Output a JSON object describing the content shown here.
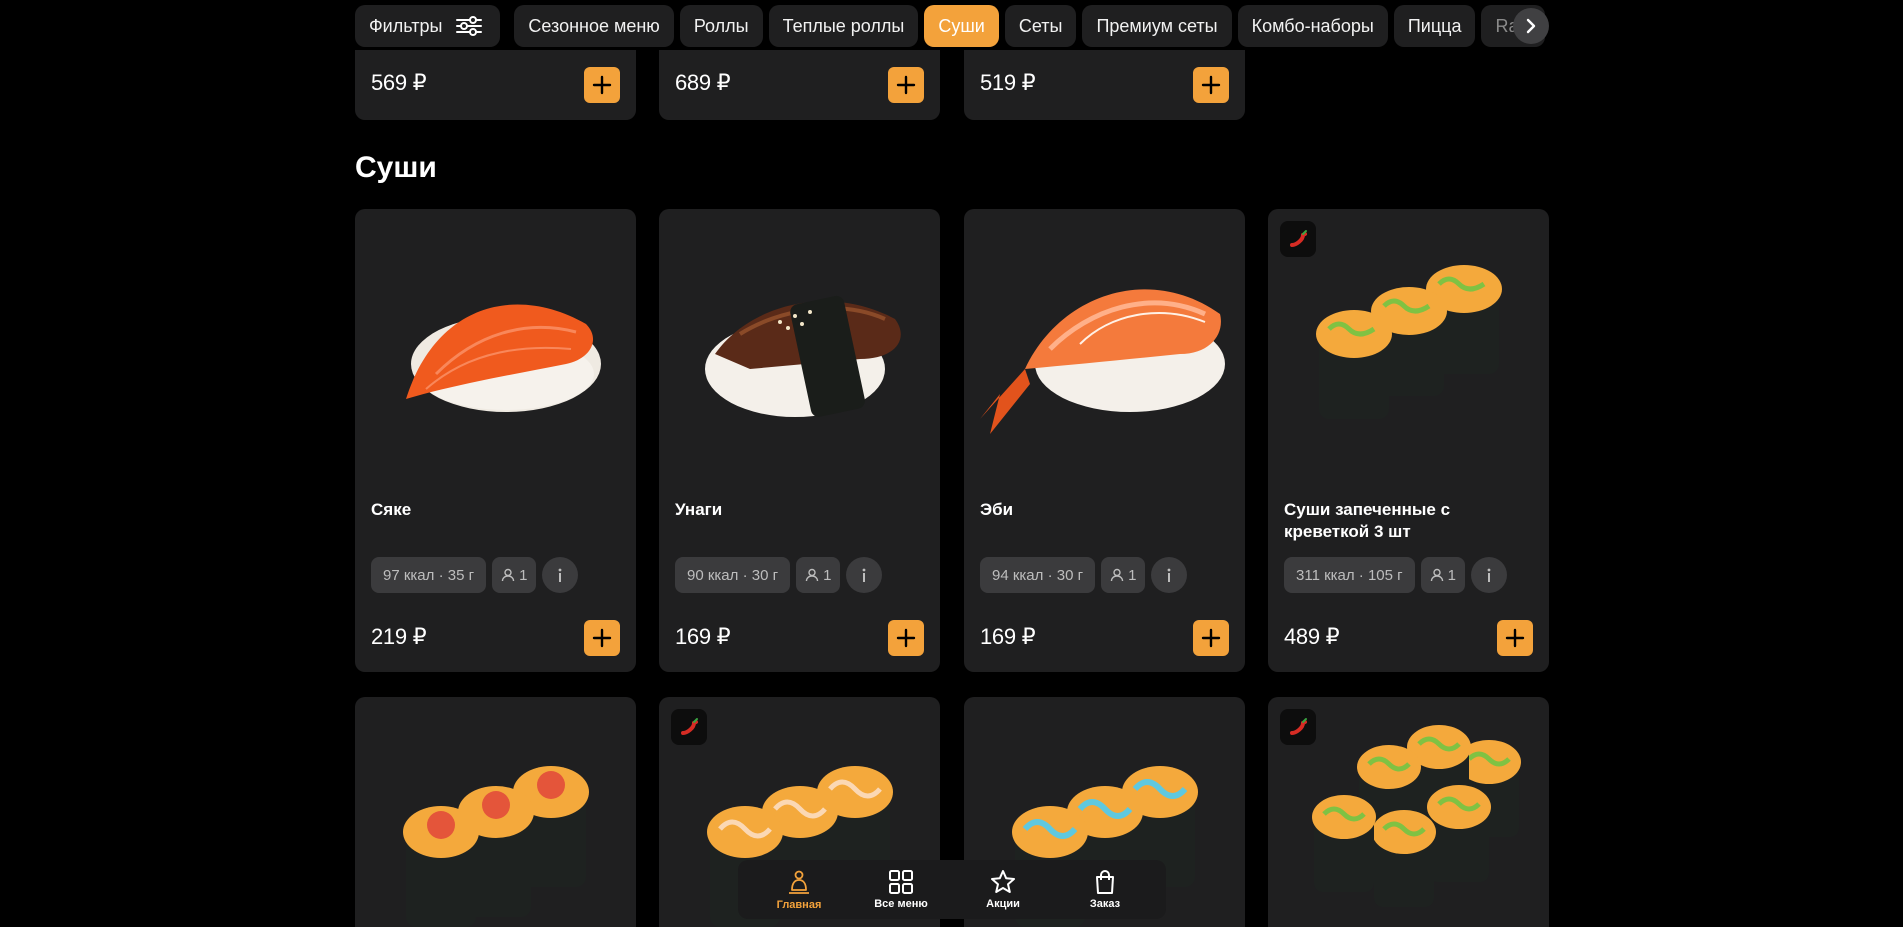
{
  "nav": {
    "filters_label": "Фильтры",
    "categories": [
      "Сезонное меню",
      "Роллы",
      "Теплые роллы",
      "Суши",
      "Сеты",
      "Премиум сеты",
      "Комбо-наборы",
      "Пицца",
      "Raw"
    ],
    "active_category": "Суши"
  },
  "previous_section": {
    "prices": [
      "569 ₽",
      "689 ₽",
      "519 ₽"
    ]
  },
  "section": {
    "title": "Суши",
    "products": [
      {
        "name": "Сяке",
        "nutrition": "97 ккал · 35 г",
        "persons": "1",
        "price": "219 ₽",
        "spicy": false,
        "image": "salmon-nigiri"
      },
      {
        "name": "Унаги",
        "nutrition": "90 ккал · 30 г",
        "persons": "1",
        "price": "169 ₽",
        "spicy": false,
        "image": "eel-nigiri"
      },
      {
        "name": "Эби",
        "nutrition": "94 ккал · 30 г",
        "persons": "1",
        "price": "169 ₽",
        "spicy": false,
        "image": "shrimp-nigiri"
      },
      {
        "name": "Суши запеченные с креветкой 3 шт",
        "nutrition": "311 ккал · 105 г",
        "persons": "1",
        "price": "489 ₽",
        "spicy": true,
        "image": "baked-sushi-green"
      }
    ],
    "row2": [
      {
        "spicy": false,
        "image": "baked-sushi-red"
      },
      {
        "spicy": true,
        "image": "baked-sushi-spicy"
      },
      {
        "spicy": false,
        "image": "baked-sushi-blue"
      },
      {
        "spicy": true,
        "image": "baked-sushi-green-6"
      }
    ]
  },
  "bottom_nav": {
    "items": [
      {
        "label": "Главная",
        "icon": "home-icon",
        "active": true
      },
      {
        "label": "Все меню",
        "icon": "grid-icon",
        "active": false
      },
      {
        "label": "Акции",
        "icon": "star-icon",
        "active": false
      },
      {
        "label": "Заказ",
        "icon": "bag-icon",
        "active": false
      }
    ]
  },
  "colors": {
    "accent": "#f3a23b",
    "card": "#1f1f20",
    "chip": "#3b3b3d",
    "background": "#000000"
  }
}
